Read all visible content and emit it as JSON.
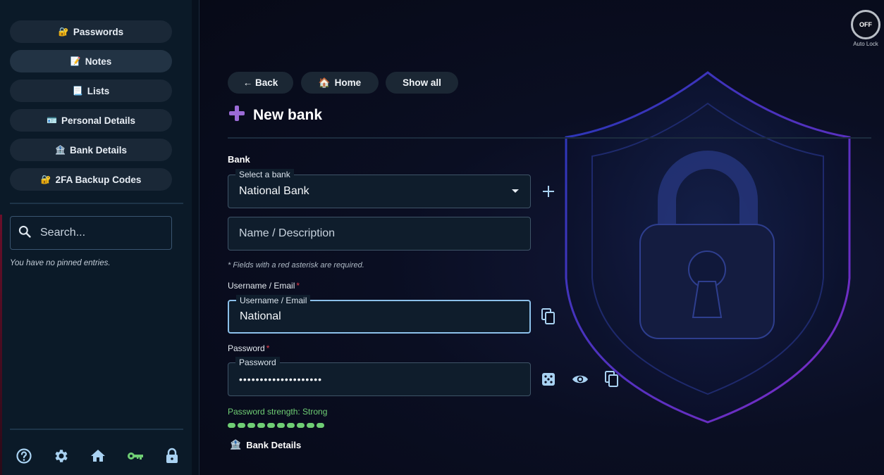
{
  "sidebar": {
    "nav": [
      {
        "icon": "🔐",
        "label": "Passwords"
      },
      {
        "icon": "📝",
        "label": "Notes"
      },
      {
        "icon": "📃",
        "label": "Lists"
      },
      {
        "icon": "🪪",
        "label": "Personal Details"
      },
      {
        "icon": "🏦",
        "label": "Bank Details"
      },
      {
        "icon": "🔐",
        "label": "2FA Backup Codes"
      }
    ],
    "search_placeholder": "Search...",
    "pinned_empty": "You have no pinned entries.",
    "bottom_icons": [
      "help-icon",
      "gear-icon",
      "home-icon",
      "key-icon",
      "lock-icon"
    ]
  },
  "autolock": {
    "state": "OFF",
    "label": "Auto Lock"
  },
  "toolbar": {
    "back_label": "← Back",
    "home_icon": "🏠",
    "home_label": "Home",
    "show_all_label": "Show all"
  },
  "page": {
    "title": "New bank",
    "bank_section": "Bank",
    "select_bank_label": "Select a bank",
    "select_bank_value": "National Bank",
    "name_placeholder": "Name / Description",
    "required_note": "* Fields with a red asterisk are required.",
    "username_label": "Username / Email",
    "username_float": "Username / Email",
    "username_value": "National",
    "password_label": "Password",
    "password_float": "Password",
    "password_value": "••••••••••••••••••••",
    "strength_text": "Password strength: Strong",
    "strength_segments": 10,
    "bank_details_icon": "🏦",
    "bank_details_label": "Bank Details"
  },
  "colors": {
    "accent_purple": "#9b6bd6",
    "strength_green": "#6fce74",
    "required_red": "#e0394a",
    "icon_blue": "#a9d2f2",
    "key_green": "#6fce74"
  }
}
